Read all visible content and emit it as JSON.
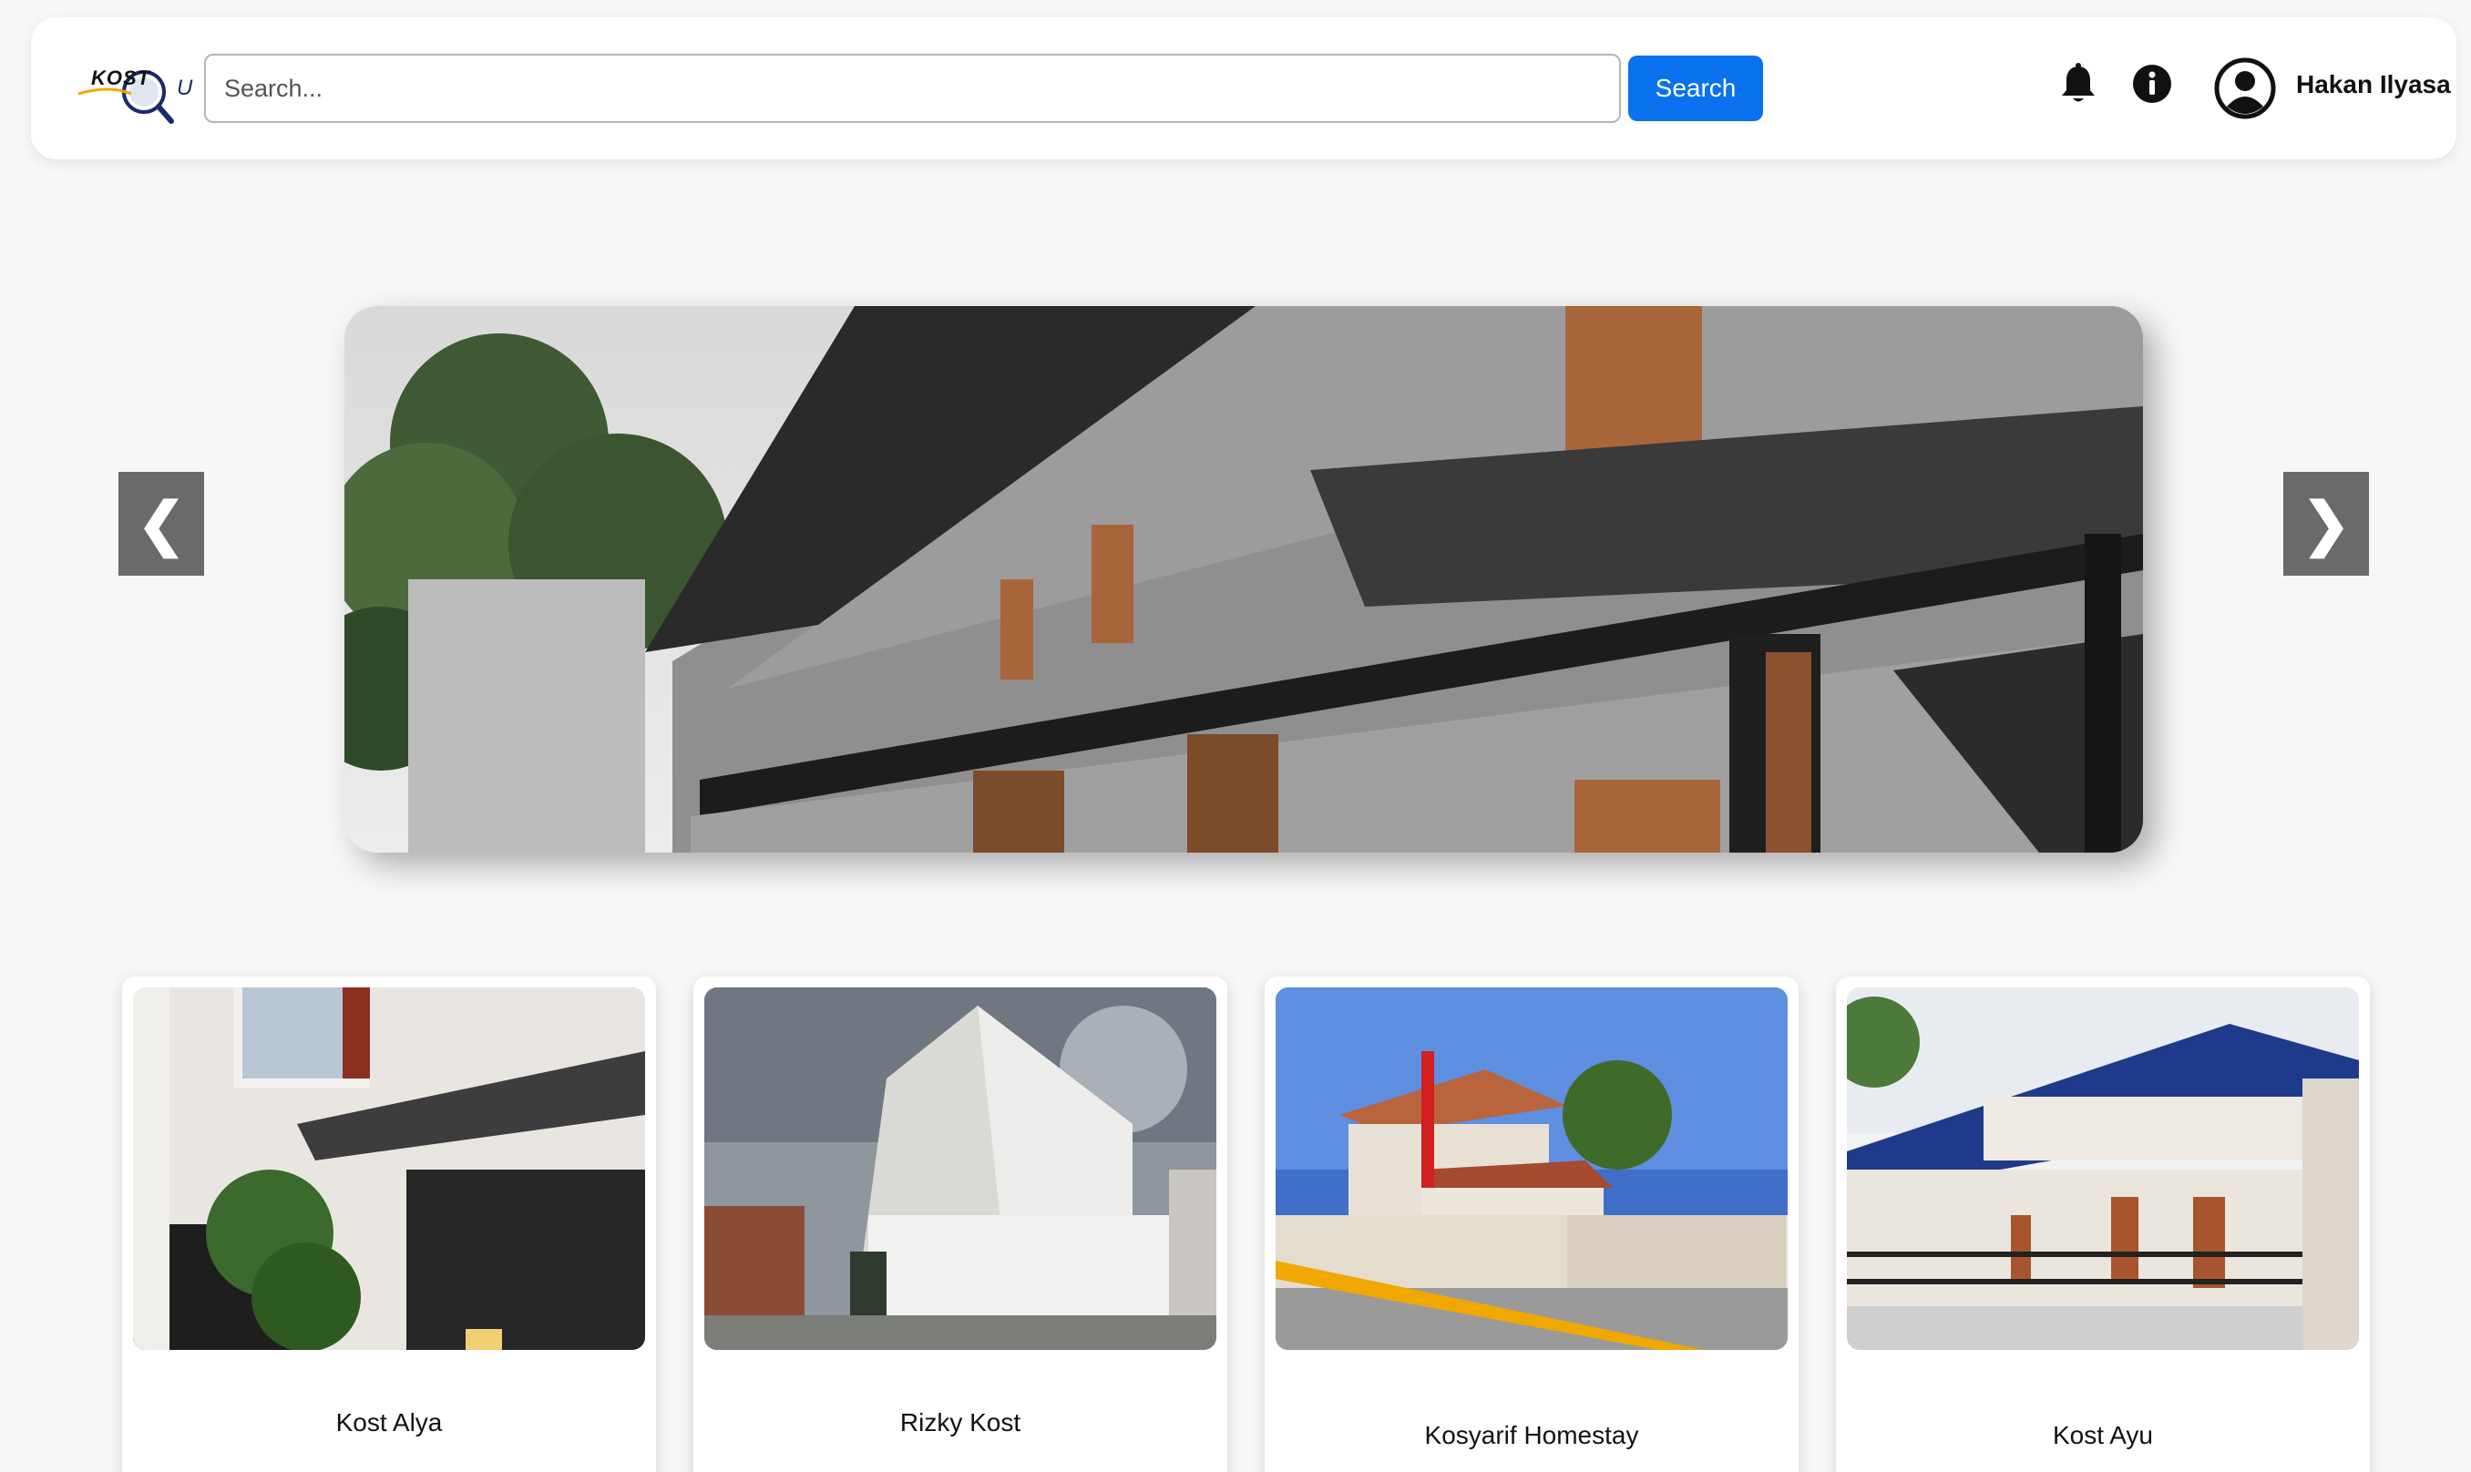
{
  "header": {
    "logo": {
      "text": "KOST",
      "suffix": "U"
    },
    "search": {
      "placeholder": "Search...",
      "button_label": "Search"
    },
    "user": {
      "name": "Hakan Ilyasa"
    }
  },
  "carousel": {
    "prev_label": "❮",
    "next_label": "❯"
  },
  "listings": [
    {
      "name": "Kost Alya"
    },
    {
      "name": "Rizky Kost"
    },
    {
      "name": "Kosyarif Homestay"
    },
    {
      "name": "Kost Ayu"
    }
  ],
  "colors": {
    "accent": "#0a72ec",
    "nav_button": "#6a6a6a",
    "page_background": "#f7f7f7"
  },
  "icons": {
    "notifications": "bell-icon",
    "info": "info-icon",
    "profile": "user-circle-icon",
    "logo": "magnifier-logo-icon"
  }
}
